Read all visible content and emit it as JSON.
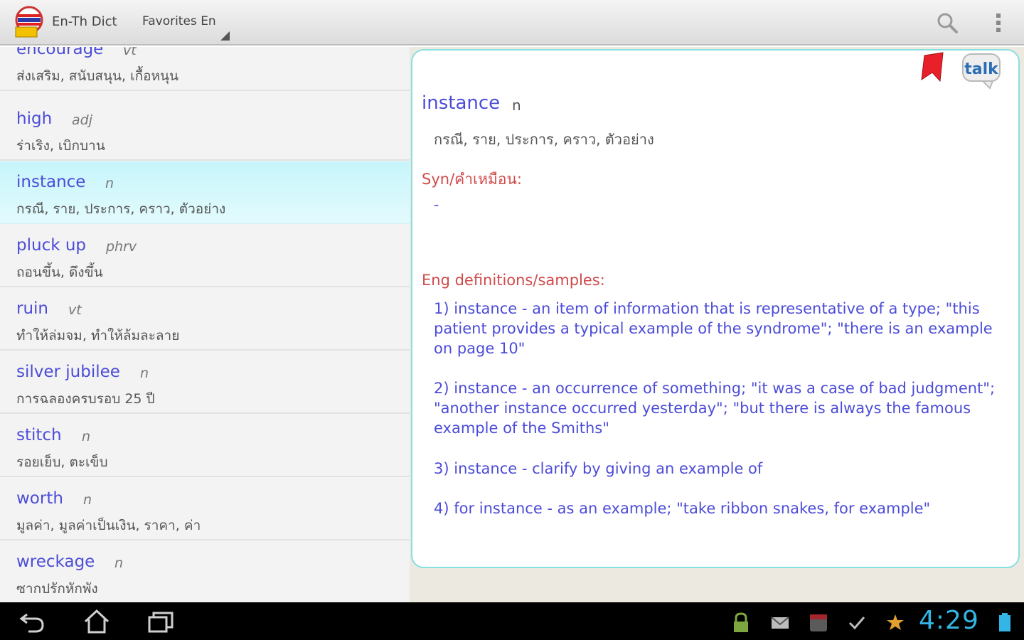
{
  "actionbar": {
    "app_title": "En-Th Dict",
    "tab_favorites": "Favorites En",
    "logo_icon": "app-logo-icon",
    "search_icon": "search-icon",
    "overflow_icon": "overflow-menu-icon"
  },
  "word_list": {
    "selected_index": 2,
    "items": [
      {
        "word": "encourage",
        "pos": "vt",
        "translation": "ส่งเสริม, สนับสนุน, เกื้อหนุน"
      },
      {
        "word": "high",
        "pos": "adj",
        "translation": "ร่าเริง, เบิกบาน"
      },
      {
        "word": "instance",
        "pos": "n",
        "translation": "กรณี, ราย, ประการ, คราว, ตัวอย่าง"
      },
      {
        "word": "pluck up",
        "pos": "phrv",
        "translation": "ถอนขึ้น, ดึงขึ้น"
      },
      {
        "word": "ruin",
        "pos": "vt",
        "translation": "ทำให้ล่มจม, ทำให้ล้มละลาย"
      },
      {
        "word": "silver jubilee",
        "pos": "n",
        "translation": "การฉลองครบรอบ 25 ปี"
      },
      {
        "word": "stitch",
        "pos": "n",
        "translation": "รอยเย็บ, ตะเข็บ"
      },
      {
        "word": "worth",
        "pos": "n",
        "translation": "มูลค่า, มูลค่าเป็นเงิน, ราคา, ค่า"
      },
      {
        "word": "wreckage",
        "pos": "n",
        "translation": "ซากปรักหักพัง"
      }
    ]
  },
  "detail": {
    "word": "instance",
    "pos": "n",
    "translation": "กรณี, ราย, ประการ, คราว, ตัวอย่าง",
    "syn_label": "Syn/คำเหมือน:",
    "syn_value": "-",
    "eng_label": "Eng definitions/samples:",
    "definitions": [
      "1) instance - an item of information that is representative of a type; \"this patient provides a typical example of the syndrome\"; \"there is an example on page 10\"",
      "2) instance - an occurrence of something; \"it was a case of bad judgment\"; \"another instance occurred yesterday\"; \"but there is always the famous example of the Smiths\"",
      "3) instance - clarify by giving an example of",
      "4) for instance - as an example; \"take ribbon snakes, for example\""
    ],
    "bookmark_icon": "bookmark-ribbon-icon",
    "talk_icon": "talk-speech-icon",
    "talk_text": "talk"
  },
  "system_bar": {
    "clock": "4:29",
    "nav_icons": [
      "back-icon",
      "home-icon",
      "recent-apps-icon"
    ],
    "tray_icons": [
      "lock-icon",
      "mail-icon",
      "calendar-icon",
      "checkmark-icon",
      "star-icon",
      "battery-icon"
    ]
  },
  "colors": {
    "word_blue": "#4c4cd8",
    "label_red": "#d04a4a",
    "selected_cyan": "#c6f5fb",
    "clock_blue": "#33b5e5"
  }
}
